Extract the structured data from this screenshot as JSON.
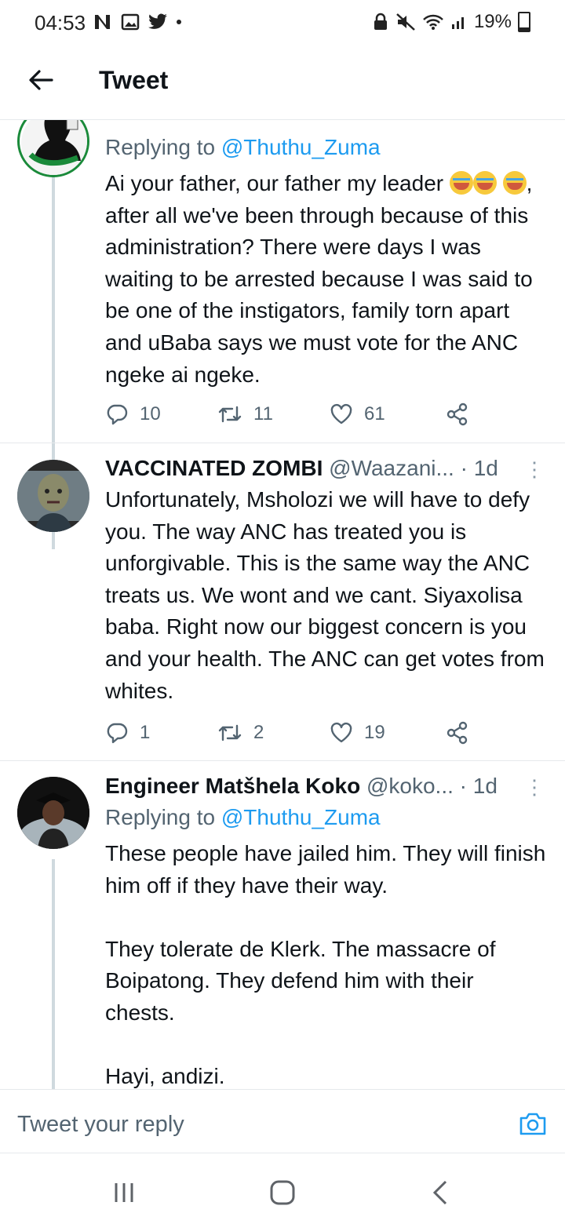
{
  "status": {
    "time": "04:53",
    "battery": "19%"
  },
  "header": {
    "title": "Tweet"
  },
  "tweets": [
    {
      "replying_prefix": "Replying to",
      "replying_to": "@Thuthu_Zuma",
      "body_1": "Ai your father, our father my leader",
      "body_2": ", after all we've been through because of this administration? There were days I was waiting to be arrested because I was said to be one of the instigators, family torn apart and uBaba says we must vote for the ANC ngeke ai ngeke.",
      "replies": "10",
      "retweets": "11",
      "likes": "61"
    },
    {
      "name": "VACCINATED ZOMBI",
      "handle": "@Waazani...",
      "time": "· 1d",
      "body": "Unfortunately, Msholozi we will have to defy you. The way ANC has treated you is unforgivable. This is the same way the ANC treats us. We wont and we cant. Siyaxolisa baba. Right now our biggest concern is you and your health. The ANC can get votes from whites.",
      "replies": "1",
      "retweets": "2",
      "likes": "19"
    },
    {
      "name": "Engineer Matšhela Koko",
      "handle": "@koko...",
      "time": "· 1d",
      "replying_prefix": "Replying to",
      "replying_to": "@Thuthu_Zuma",
      "body": "These people have jailed him. They will finish him off if they have their way.\n\nThey tolerate de Klerk. The massacre of Boipatong. They defend him with their chests.\n\nHayi, andizi."
    }
  ],
  "compose": {
    "placeholder": "Tweet your reply"
  },
  "colors": {
    "accent": "#1d9bf0",
    "secondary_text": "#536471",
    "thread_line": "#cfd9de"
  },
  "icons": [
    "back-arrow-icon",
    "reply-icon",
    "retweet-icon",
    "like-icon",
    "share-icon",
    "more-icon",
    "camera-icon"
  ]
}
